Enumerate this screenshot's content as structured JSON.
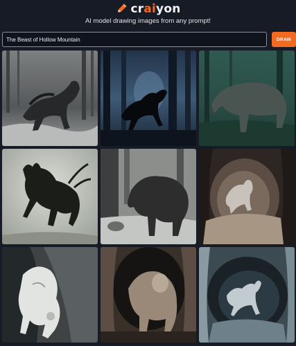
{
  "brand": {
    "name_prefix": "cr",
    "name_accent": "ai",
    "name_suffix": "yon",
    "icon": "pencil-icon",
    "accent_color": "#f26b21"
  },
  "tagline": "AI model drawing images from any prompt!",
  "prompt": {
    "value": "The Beast of Hollow Mountain",
    "draw_label": "DRAW"
  },
  "gallery": {
    "images": [
      {
        "label": "Generated image 1"
      },
      {
        "label": "Generated image 2"
      },
      {
        "label": "Generated image 3"
      },
      {
        "label": "Generated image 4"
      },
      {
        "label": "Generated image 5"
      },
      {
        "label": "Generated image 6"
      },
      {
        "label": "Generated image 7"
      },
      {
        "label": "Generated image 8"
      },
      {
        "label": "Generated image 9"
      }
    ]
  }
}
